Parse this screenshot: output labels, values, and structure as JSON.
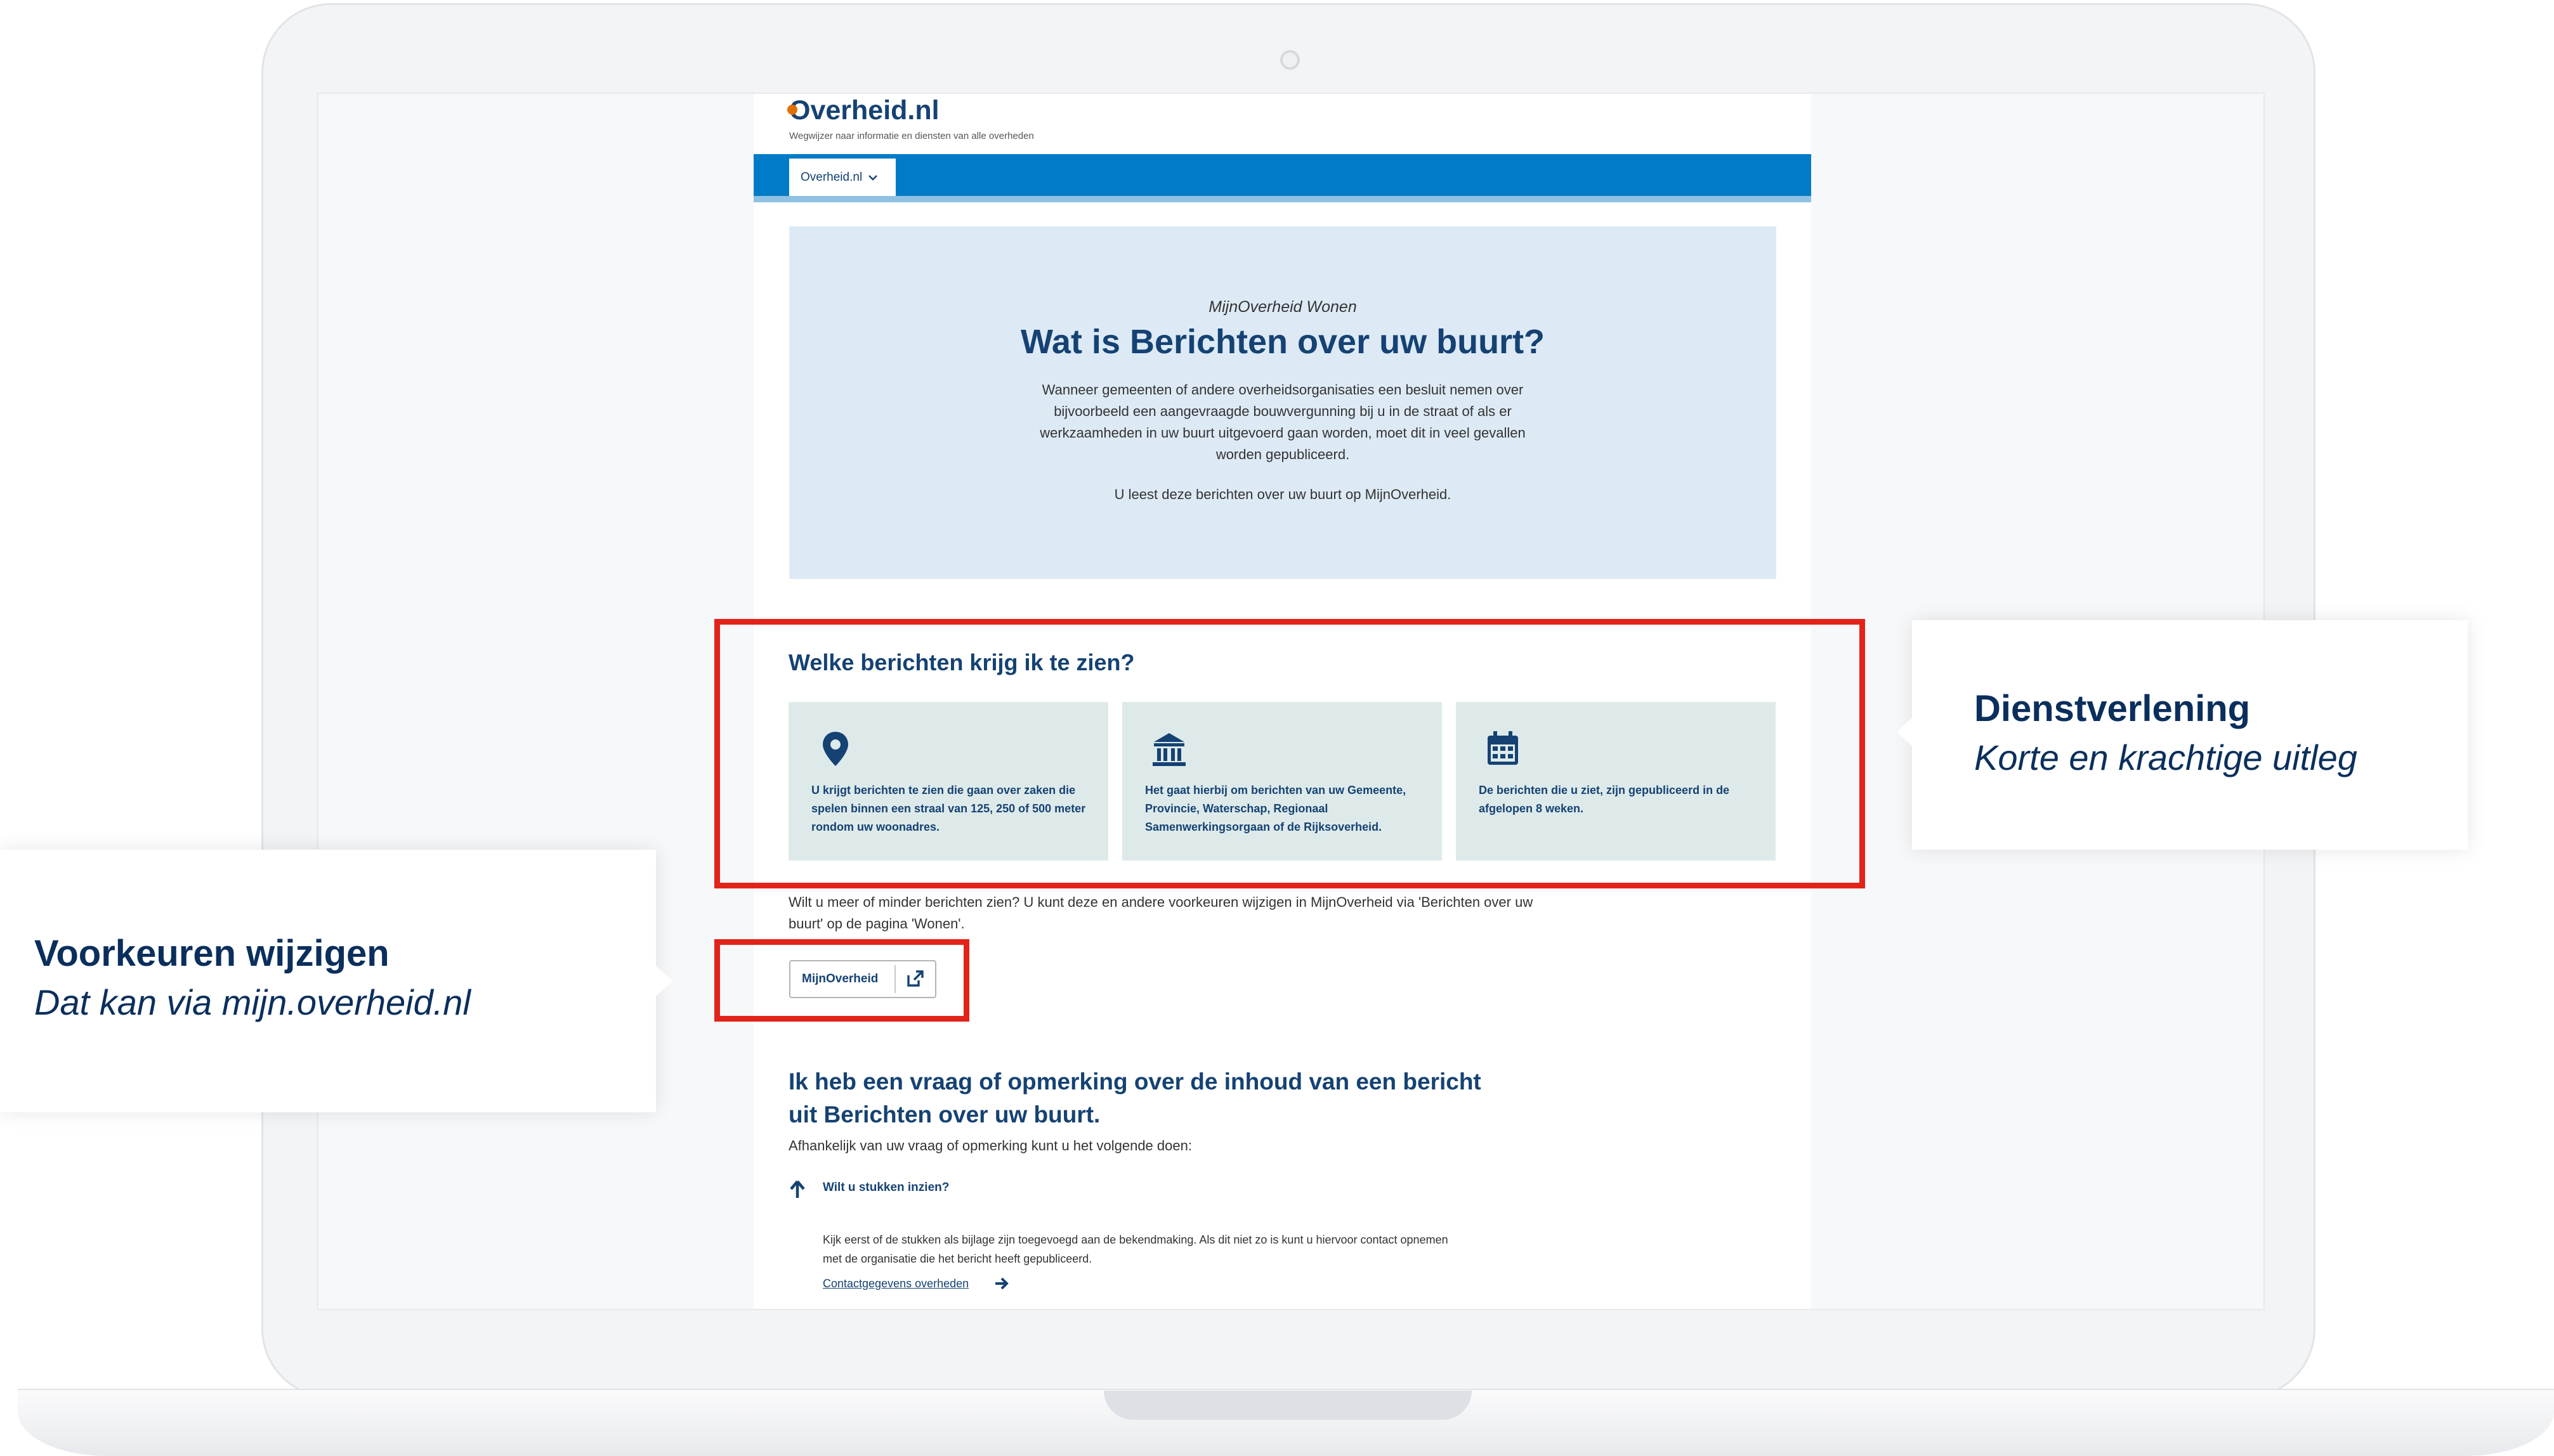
{
  "site": {
    "logo": "Overheid.nl",
    "tagline": "Wegwijzer naar informatie en diensten van alle overheden",
    "nav_tab": "Overheid.nl"
  },
  "hero": {
    "kicker": "MijnOverheid Wonen",
    "title": "Wat is Berichten over uw buurt?",
    "body": "Wanneer gemeenten of andere overheidsorganisaties een besluit nemen over bijvoorbeeld een aangevraagde bouwvergunning bij u in de straat of als er werkzaamheden in uw buurt uitgevoerd gaan worden, moet dit in veel gevallen worden gepubliceerd.",
    "footnote": "U leest deze berichten over uw buurt op MijnOverheid."
  },
  "messages_section": {
    "title": "Welke berichten krijg ik te zien?",
    "cards": [
      {
        "icon": "location-pin-icon",
        "text": "U krijgt berichten te zien die gaan over zaken die spelen binnen een straal van 125, 250 of 500 meter rondom uw woonadres."
      },
      {
        "icon": "government-building-icon",
        "text": "Het gaat hierbij om berichten van uw Gemeente, Provincie, Waterschap, Regionaal Samenwerkingsorgaan of de Rijksoverheid."
      },
      {
        "icon": "calendar-icon",
        "text": "De berichten die u ziet, zijn gepubliceerd in de afgelopen 8 weken."
      }
    ]
  },
  "preferences": {
    "text": "Wilt u meer of minder berichten zien? U kunt deze en andere voorkeuren wijzigen in MijnOverheid via 'Berichten over uw buurt' op de pagina 'Wonen'.",
    "button_label": "MijnOverheid"
  },
  "question_section": {
    "title": "Ik heb een vraag of opmerking over de inhoud van een bericht uit Berichten over uw buurt.",
    "subtitle": "Afhankelijk van uw vraag of opmerking kunt u het volgende doen:",
    "item_label": "Wilt u stukken inzien?",
    "item_body": "Kijk eerst of de stukken als bijlage zijn toegevoegd aan de bekendmaking. Als dit niet zo is kunt u hiervoor contact opnemen met de organisatie die het bericht heeft gepubliceerd.",
    "link": "Contactgegevens overheden"
  },
  "callouts": {
    "right": {
      "title": "Dienstverlening",
      "subtitle": "Korte en krachtige uitleg"
    },
    "left": {
      "title": "Voorkeuren wijzigen",
      "subtitle": "Dat kan via mijn.overheid.nl"
    }
  },
  "colors": {
    "brand_blue": "#154273",
    "nav_blue": "#007bc7",
    "hero_bg": "#ddeaf6",
    "card_bg": "#deeaea",
    "highlight_red": "#e2231a"
  }
}
